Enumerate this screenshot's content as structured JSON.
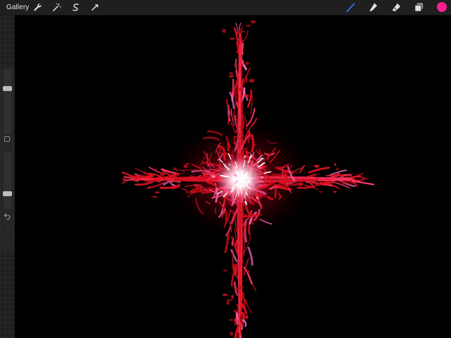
{
  "toolbar": {
    "gallery_label": "Gallery",
    "tools_left": [
      {
        "name": "wrench-icon",
        "color": "#e0e0e0"
      },
      {
        "name": "magic-wand-icon",
        "color": "#e0e0e0"
      },
      {
        "name": "selection-icon",
        "color": "#e0e0e0"
      },
      {
        "name": "move-arrow-icon",
        "color": "#e0e0e0"
      }
    ],
    "tools_right": [
      {
        "name": "brush-icon",
        "color": "#2f7cf6",
        "active": true
      },
      {
        "name": "smudge-icon",
        "color": "#e0e0e0"
      },
      {
        "name": "eraser-icon",
        "color": "#e0e0e0"
      },
      {
        "name": "layers-icon",
        "color": "#e0e0e0"
      }
    ],
    "current_color": "#ff1f8e"
  },
  "sidebar": {
    "brush_size_level": 0.72,
    "opacity_level": 0.25,
    "modify_icon": "square-icon",
    "undo_icon": "undo-icon",
    "redo_icon": "redo-icon"
  },
  "canvas": {
    "background": "#000000",
    "artwork": {
      "description_colors": {
        "primary": "#e0101e",
        "secondary": "#ff3b6b",
        "highlight": "#ff7ad0",
        "core": "#ffffff"
      }
    }
  }
}
